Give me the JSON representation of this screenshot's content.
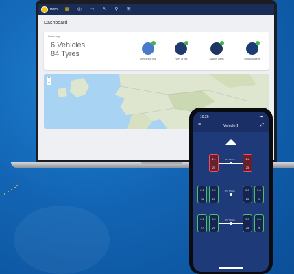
{
  "topbar": {
    "logo_text": "Hero",
    "icons": [
      "dashboard-icon",
      "tyre-icon",
      "vehicle-icon",
      "user-icon",
      "location-icon",
      "chart-icon"
    ]
  },
  "dashboard": {
    "title": "Dashboard",
    "summary": {
      "title": "Summary",
      "vehicles": "6 Vehicles",
      "tyres": "84 Tyres",
      "metrics": [
        {
          "label": "Vehicles at risk",
          "color": "#4a79c8"
        },
        {
          "label": "Tyres at risk",
          "color": "#203a70"
        },
        {
          "label": "System alerts",
          "color": "#1f3563"
        },
        {
          "label": "Gateway alerts",
          "color": "#1b3c75"
        }
      ]
    }
  },
  "phone": {
    "time": "10:26",
    "status_icons": "▪▪▪",
    "title": "Vehicle 1",
    "menu_icon": "≡",
    "action_icon": "⤢",
    "axles": [
      {
        "label": "Pr: 1.5 bar",
        "tyres": [
          {
            "pos": "1.1",
            "val": "25",
            "alert": true
          },
          {
            "pos": "1.2",
            "val": "25",
            "alert": true
          }
        ]
      },
      {
        "label": "Pr: 7.6 bar",
        "tyres": [
          {
            "pos": "2.1",
            "val": "26"
          },
          {
            "pos": "2.2",
            "val": "25"
          },
          {
            "pos": "2.3",
            "val": "25"
          },
          {
            "pos": "2.4",
            "val": "26"
          }
        ]
      },
      {
        "label": "Pr: 7.6 bar",
        "tyres": [
          {
            "pos": "3.1",
            "val": "27"
          },
          {
            "pos": "3.2",
            "val": "25"
          },
          {
            "pos": "3.3",
            "val": "25"
          },
          {
            "pos": "3.4",
            "val": "26"
          }
        ]
      }
    ]
  },
  "colors": {
    "background": "#1265b4",
    "app_header": "#1a2d57",
    "ok": "#4fbf6a",
    "alert": "#ff4a5a",
    "accent": "#f5c400"
  }
}
